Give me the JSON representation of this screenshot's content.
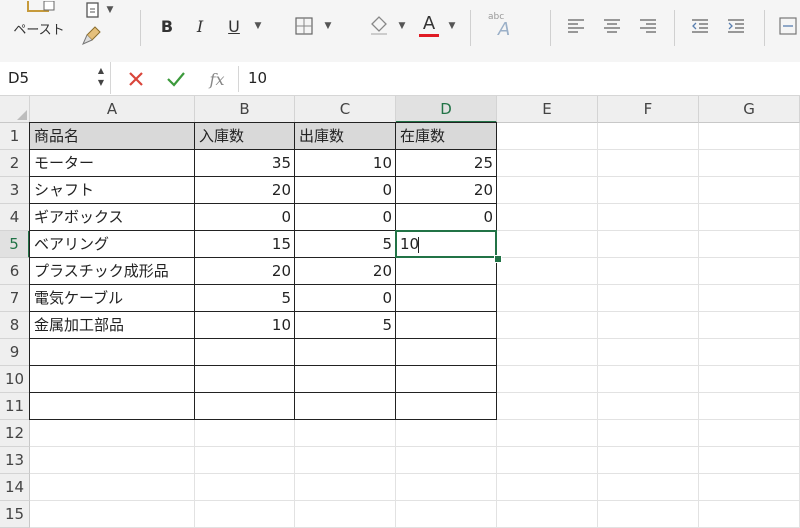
{
  "ribbon": {
    "paste_label": "ペースト",
    "bold": "B",
    "italic": "I",
    "underline": "U",
    "font_color_letter": "A",
    "abc_label": "abc"
  },
  "formula_bar": {
    "name_box": "D5",
    "fx_label": "fx",
    "value": "10"
  },
  "columns": [
    "A",
    "B",
    "C",
    "D",
    "E",
    "F",
    "G"
  ],
  "rows": [
    "1",
    "2",
    "3",
    "4",
    "5",
    "6",
    "7",
    "8",
    "9",
    "10",
    "11",
    "12",
    "13",
    "14",
    "15"
  ],
  "table": {
    "headers": [
      "商品名",
      "入庫数",
      "出庫数",
      "在庫数"
    ],
    "rows": [
      {
        "name": "モーター",
        "in": "35",
        "out": "10",
        "stock": "25"
      },
      {
        "name": "シャフト",
        "in": "20",
        "out": "0",
        "stock": "20"
      },
      {
        "name": "ギアボックス",
        "in": "0",
        "out": "0",
        "stock": "0"
      },
      {
        "name": "ベアリング",
        "in": "15",
        "out": "5",
        "stock": "10"
      },
      {
        "name": "プラスチック成形品",
        "in": "20",
        "out": "20",
        "stock": ""
      },
      {
        "name": "電気ケーブル",
        "in": "5",
        "out": "0",
        "stock": ""
      },
      {
        "name": "金属加工部品",
        "in": "10",
        "out": "5",
        "stock": ""
      },
      {
        "name": "",
        "in": "",
        "out": "",
        "stock": ""
      },
      {
        "name": "",
        "in": "",
        "out": "",
        "stock": ""
      },
      {
        "name": "",
        "in": "",
        "out": "",
        "stock": ""
      }
    ]
  },
  "active_cell": "D5",
  "colors": {
    "accent": "#217346",
    "font_color_bar": "#e01b24",
    "header_fill": "#d9d9d9"
  }
}
